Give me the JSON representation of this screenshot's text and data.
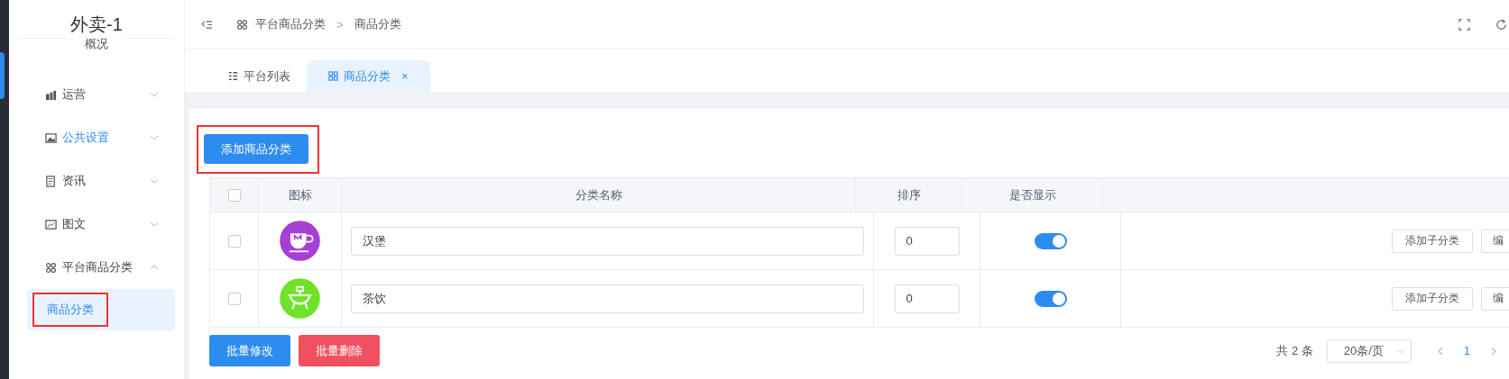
{
  "sidebar": {
    "title": "外卖-1",
    "subtitle": "概况",
    "items": [
      {
        "label": "运营",
        "kind": "chart",
        "selected": false,
        "expanded": false
      },
      {
        "label": "公共设置",
        "kind": "image",
        "selected": true,
        "expanded": false
      },
      {
        "label": "资讯",
        "kind": "doc",
        "selected": false,
        "expanded": false
      },
      {
        "label": "图文",
        "kind": "picture",
        "selected": false,
        "expanded": false
      },
      {
        "label": "平台商品分类",
        "kind": "grid",
        "selected": false,
        "expanded": true,
        "children": [
          {
            "label": "商品分类",
            "selected": true,
            "highlighted": true
          }
        ]
      }
    ]
  },
  "header": {
    "breadcrumb": [
      "平台商品分类",
      "商品分类"
    ],
    "separator": ">"
  },
  "tabs": [
    {
      "label": "平台列表",
      "kind": "list",
      "selected": false
    },
    {
      "label": "商品分类",
      "kind": "grid",
      "selected": true,
      "close": "×"
    }
  ],
  "add_button": {
    "label": "添加商品分类",
    "highlighted": true
  },
  "table": {
    "columns": [
      "图标",
      "分类名称",
      "排序",
      "是否显示"
    ],
    "header_checked": false,
    "rows": [
      {
        "checked": false,
        "kind": "cup",
        "color": "#a63fd6",
        "name": "汉堡",
        "sort": "0",
        "shown": true,
        "actions": [
          "添加子分类",
          "编"
        ]
      },
      {
        "checked": false,
        "kind": "pot",
        "color": "#6fe22a",
        "name": "茶饮",
        "sort": "0",
        "shown": true,
        "actions": [
          "添加子分类",
          "编"
        ]
      }
    ]
  },
  "bulk_actions": [
    {
      "label": "批量修改",
      "kind": "primary"
    },
    {
      "label": "批量删除",
      "kind": "danger"
    }
  ],
  "pagination": {
    "total": "共 2 条",
    "page_size": "20条/页",
    "pages": [
      {
        "label": "1",
        "selected": true
      }
    ]
  }
}
